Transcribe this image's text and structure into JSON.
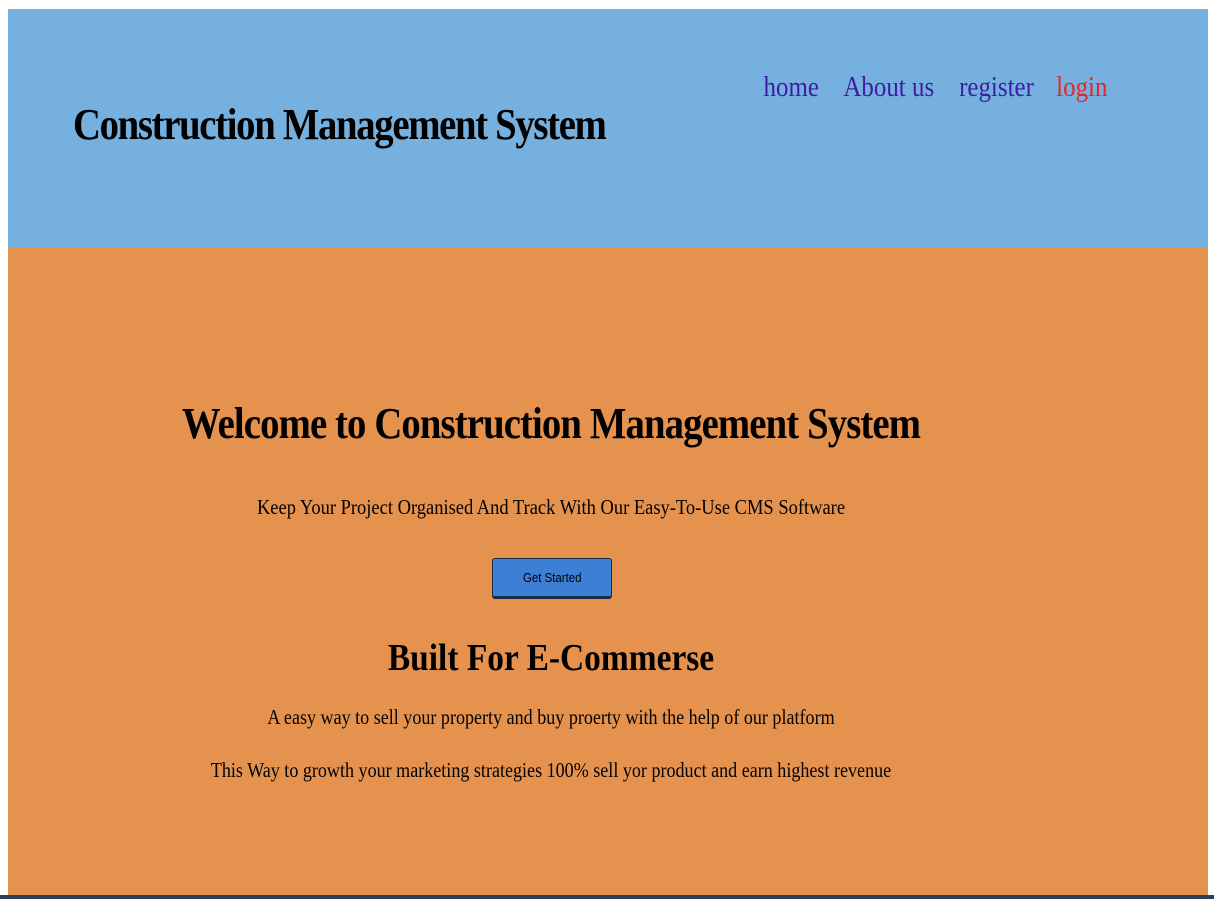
{
  "header": {
    "title": "Construction Management System",
    "nav": {
      "home": "home",
      "about": "About us",
      "register": "register",
      "login": "login"
    }
  },
  "main": {
    "welcome": "Welcome to Construction Management System",
    "tagline": "Keep Your Project Organised And Track With Our Easy-To-Use CMS Software",
    "cta_label": "Get Started",
    "subheading": "Built For E-Commerse",
    "line1": "A easy way to sell your property and buy proerty with the help of our platform",
    "line2": "This Way to growth your marketing strategies 100% sell yor product and earn highest revenue"
  },
  "colors": {
    "header_bg": "#76b0de",
    "main_bg": "#e6924f",
    "nav_link": "#3c1ea3",
    "nav_active": "#e5252a",
    "button_bg": "#3e7fd6"
  }
}
